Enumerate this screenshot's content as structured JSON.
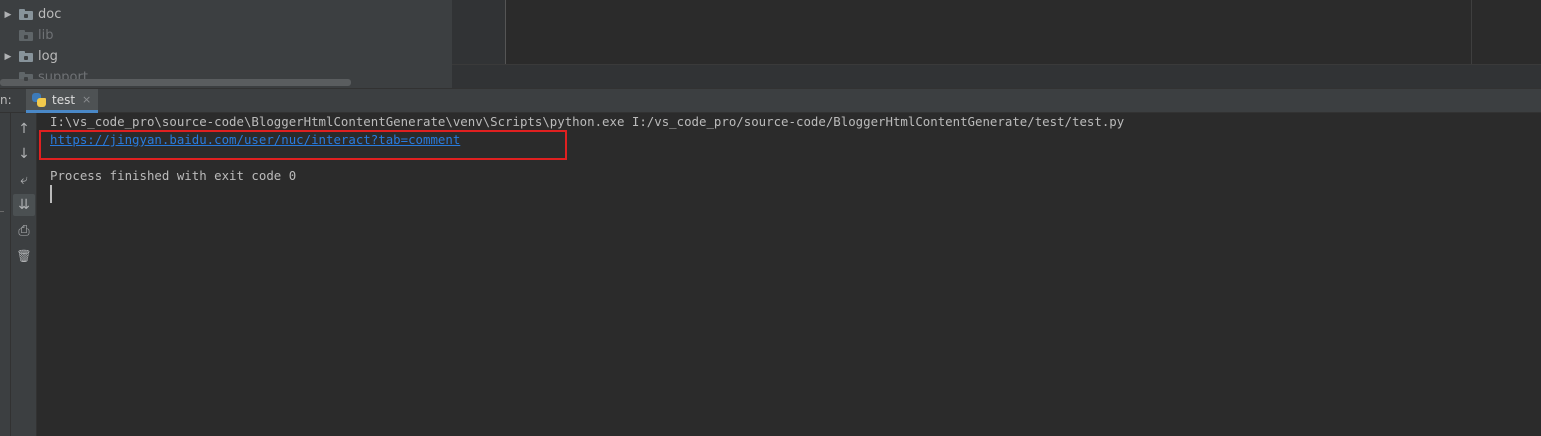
{
  "project_tree": {
    "items": [
      {
        "label": "doc",
        "expandable": true,
        "dim": false
      },
      {
        "label": "lib",
        "expandable": false,
        "dim": true
      },
      {
        "label": "log",
        "expandable": true,
        "dim": false
      },
      {
        "label": "support",
        "expandable": false,
        "dim": true
      }
    ]
  },
  "run_panel": {
    "label": "n:",
    "tab": {
      "label": "test",
      "close": "×",
      "icon": "python-icon"
    }
  },
  "toolbar": {
    "buttons": [
      {
        "name": "scroll-up-button",
        "icon": "↑"
      },
      {
        "name": "scroll-down-button",
        "icon": "↓"
      },
      {
        "name": "soft-wrap-button",
        "icon": "⤶"
      },
      {
        "name": "scroll-to-end-button",
        "icon": "⇊"
      },
      {
        "name": "print-button",
        "icon": "⎙"
      },
      {
        "name": "clear-all-button",
        "icon": "🗑"
      }
    ]
  },
  "console": {
    "command": "I:\\vs_code_pro\\source-code\\BloggerHtmlContentGenerate\\venv\\Scripts\\python.exe I:/vs_code_pro/source-code/BloggerHtmlContentGenerate/test/test.py",
    "link": "https://jingyan.baidu.com/user/nuc/interact?tab=comment",
    "exit_message": "Process finished with exit code 0"
  },
  "colors": {
    "highlight_border": "#e02020",
    "link": "#287bde",
    "tab_accent": "#4a88c7"
  }
}
